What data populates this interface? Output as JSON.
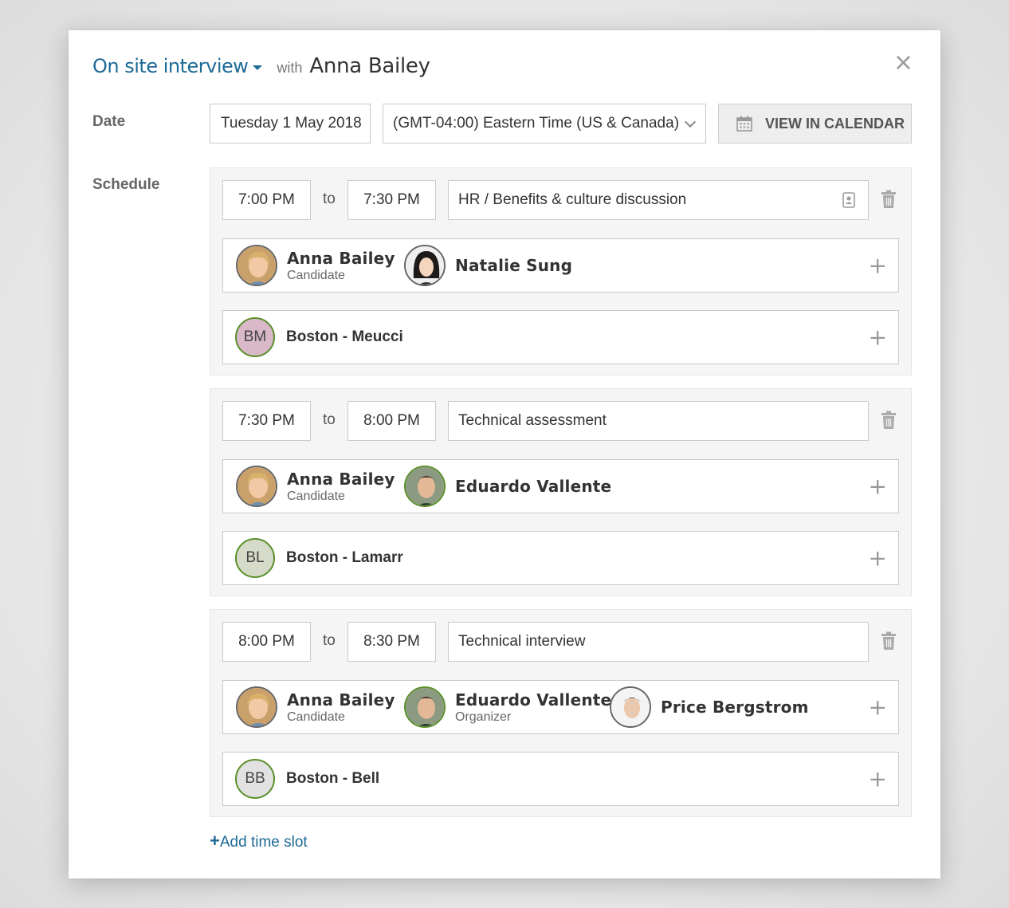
{
  "header": {
    "interview_type": "On site interview",
    "with_label": "with",
    "candidate_name": "Anna Bailey",
    "close_label": "×"
  },
  "date_section": {
    "label": "Date",
    "date_value": "Tuesday 1 May 2018",
    "timezone_value": "(GMT-04:00) Eastern Time (US & Canada)",
    "calendar_button": "VIEW IN CALENDAR"
  },
  "schedule": {
    "label": "Schedule",
    "to_label": "to",
    "slots": [
      {
        "start": "7:00 PM",
        "end": "7:30 PM",
        "topic": "HR / Benefits & culture discussion",
        "people": [
          {
            "name": "Anna Bailey",
            "role": "Candidate"
          },
          {
            "name": "Natalie Sung",
            "role": ""
          }
        ],
        "room": {
          "initials": "BM",
          "name": "Boston - Meucci",
          "color": "#d9b8c8"
        }
      },
      {
        "start": "7:30 PM",
        "end": "8:00 PM",
        "topic": "Technical assessment",
        "people": [
          {
            "name": "Anna Bailey",
            "role": "Candidate"
          },
          {
            "name": "Eduardo Vallente",
            "role": ""
          }
        ],
        "room": {
          "initials": "BL",
          "name": "Boston - Lamarr",
          "color": "#d6dbc9"
        }
      },
      {
        "start": "8:00 PM",
        "end": "8:30 PM",
        "topic": "Technical interview",
        "people": [
          {
            "name": "Anna Bailey",
            "role": "Candidate"
          },
          {
            "name": "Eduardo Vallente",
            "role": "Organizer"
          },
          {
            "name": "Price Bergstrom",
            "role": ""
          }
        ],
        "room": {
          "initials": "BB",
          "name": "Boston - Bell",
          "color": "#e2e2e2"
        }
      }
    ],
    "add_slot_plus": "+",
    "add_slot_label": "Add time slot"
  },
  "icons": {
    "close": "close-icon",
    "dropdown": "chevron-down-icon",
    "calendar": "calendar-icon",
    "contact_card": "contact-card-icon",
    "trash": "trash-icon",
    "add": "plus-icon"
  },
  "colors": {
    "accent": "#1d6a96",
    "room_border": "#5a8f2a"
  }
}
